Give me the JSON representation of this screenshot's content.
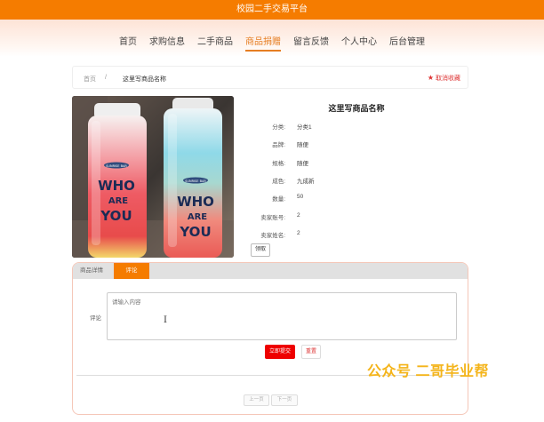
{
  "header": {
    "site_title": "校园二手交易平台"
  },
  "nav": {
    "items": [
      "首页",
      "求购信息",
      "二手商品",
      "商品捐赠",
      "留言反馈",
      "个人中心",
      "后台管理"
    ],
    "active_index": 3
  },
  "breadcrumb": {
    "home": "首页",
    "separator": "/",
    "current": "这里写商品名称"
  },
  "favorite": {
    "label": "取消收藏"
  },
  "product": {
    "title": "这里写商品名称",
    "fields": [
      {
        "key": "分类:",
        "value": "分类1"
      },
      {
        "key": "品牌:",
        "value": "随便"
      },
      {
        "key": "规格:",
        "value": "随便"
      },
      {
        "key": "成色:",
        "value": "九成新"
      },
      {
        "key": "数量:",
        "value": "50"
      },
      {
        "key": "卖家账号:",
        "value": "2"
      },
      {
        "key": "卖家姓名:",
        "value": "2"
      }
    ],
    "cancel_label": "领取",
    "photo_text": {
      "bottle_brand": "SUNRISE BAR",
      "left_bottle": [
        "WHO",
        "ARE",
        "YOU"
      ],
      "right_bottle": [
        "WHO",
        "ARE",
        "YOU"
      ]
    }
  },
  "tabs": {
    "items": [
      "商品详情",
      "评论"
    ],
    "active_index": 1
  },
  "comment": {
    "label": "评论",
    "placeholder": "请输入内容",
    "submit_label": "立即提交",
    "reset_label": "重置"
  },
  "pagination": {
    "prev_label": "上一页",
    "next_label": "下一页"
  },
  "watermark": {
    "text": "公众号 二哥毕业帮"
  },
  "colors": {
    "brand_orange": "#f57c00",
    "submit_red": "#ee0000",
    "watermark_gold": "#f4b41a"
  }
}
